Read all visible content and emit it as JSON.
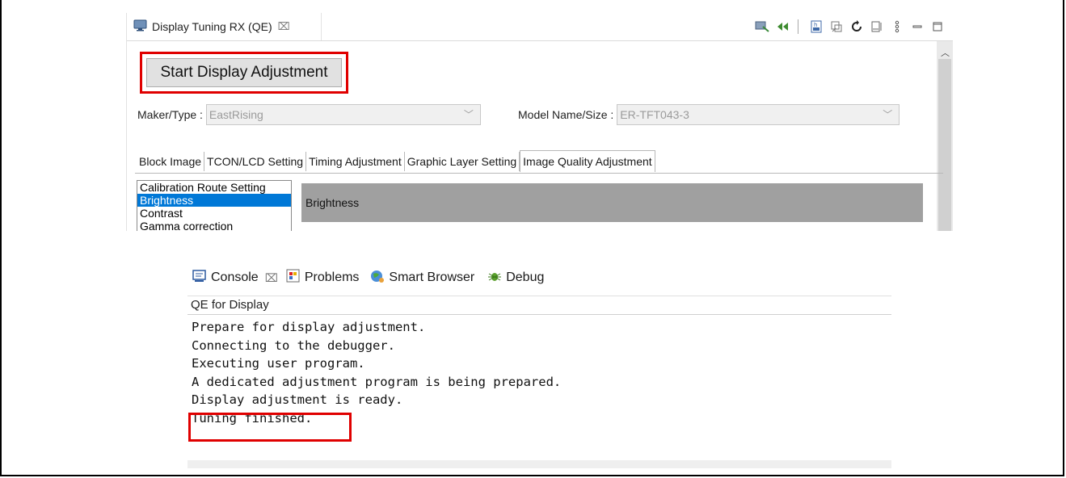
{
  "display_tuning": {
    "tab_title": "Display Tuning RX (QE)",
    "tab_close": "⌧",
    "start_button": "Start Display Adjustment",
    "maker_label": "Maker/Type :",
    "maker_value": "EastRising",
    "model_label": "Model Name/Size :",
    "model_value": "ER-TFT043-3",
    "tabs": [
      "Block Image",
      "TCON/LCD Setting",
      "Timing Adjustment",
      "Graphic Layer Setting",
      "Image Quality Adjustment"
    ],
    "active_tab": "Image Quality Adjustment",
    "list_items": [
      "Calibration Route Setting",
      "Brightness",
      "Contrast",
      "Gamma correction"
    ],
    "selected_item": "Brightness",
    "section_header": "Brightness"
  },
  "console": {
    "tabs": [
      "Console",
      "Problems",
      "Smart Browser",
      "Debug"
    ],
    "console_close": "⌧",
    "title": "QE for Display",
    "lines": [
      "Prepare for display adjustment.",
      "Connecting to the debugger.",
      "Executing user program.",
      "A dedicated adjustment program is being prepared.",
      "Display adjustment is ready.",
      "Tuning finished."
    ]
  },
  "colors": {
    "highlight_red": "#e00000",
    "selection_blue": "#0078d7"
  }
}
